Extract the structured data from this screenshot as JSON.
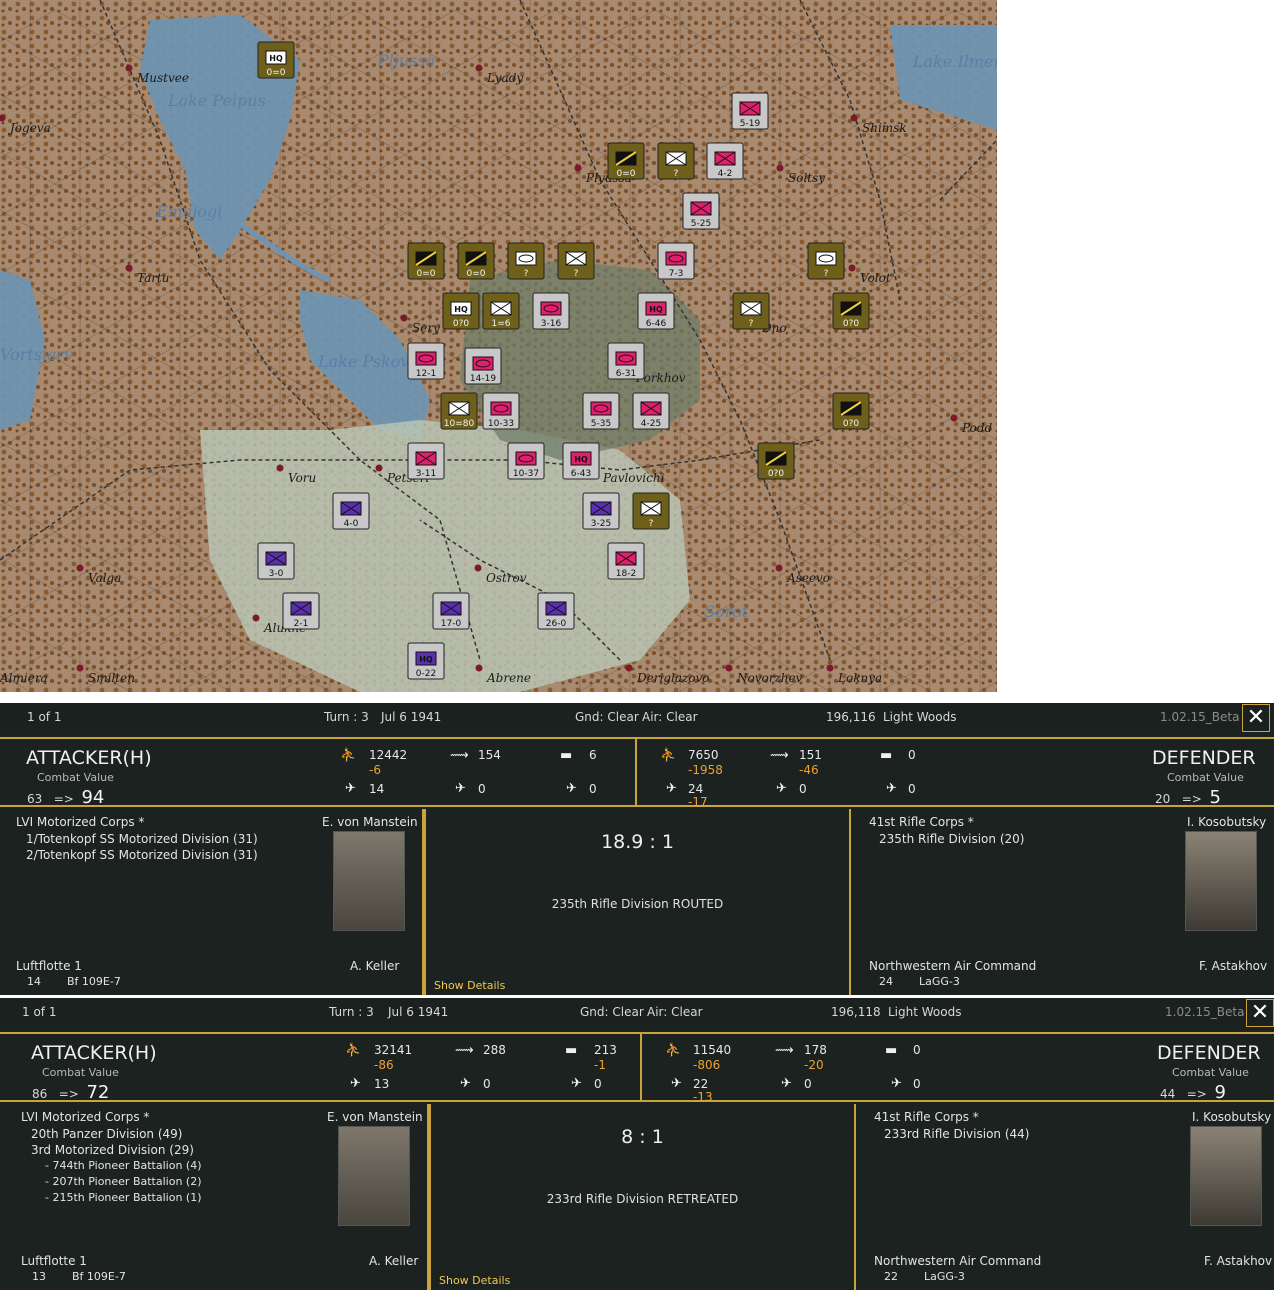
{
  "map": {
    "place_names": [
      "Mustvee",
      "Lake Peipus",
      "Jogeva",
      "Pljussa",
      "Lyady",
      "Lake Ilmen",
      "Shimsk",
      "Soltsy",
      "Plyussa",
      "Emajogi",
      "Tartu",
      "Volot",
      "Lake Pskov",
      "Porkhov",
      "Dno",
      "Vortsjarv",
      "Voru",
      "Petseri",
      "Pavlovichi",
      "Podd",
      "Valga",
      "Ostrov",
      "Aseevo",
      "Alukne",
      "Sorot",
      "Almiera",
      "Smilten",
      "Abrene",
      "Deriglazovo",
      "Novorzhev",
      "Loknya",
      "Sery"
    ],
    "units": [
      {
        "label": "0=0",
        "type": "HQ",
        "side": "german"
      },
      {
        "label": "5-19",
        "type": "infantry",
        "side": "soviet"
      },
      {
        "label": "0=0",
        "type": "R",
        "side": "german"
      },
      {
        "label": "?",
        "type": "infantry",
        "side": "soviet-hidden"
      },
      {
        "label": "4-2",
        "type": "infantry",
        "side": "soviet"
      },
      {
        "label": "5-25",
        "type": "infantry",
        "side": "soviet"
      },
      {
        "label": "0=0",
        "type": "R",
        "side": "german"
      },
      {
        "label": "0=0",
        "type": "R",
        "side": "german"
      },
      {
        "label": "?",
        "type": "armor",
        "side": "soviet-hidden"
      },
      {
        "label": "?",
        "type": "infantry",
        "side": "soviet-hidden"
      },
      {
        "label": "7-3",
        "type": "armor",
        "side": "soviet"
      },
      {
        "label": "?",
        "type": "armor",
        "side": "soviet-hidden"
      },
      {
        "label": "0?0",
        "type": "HQ",
        "side": "german"
      },
      {
        "label": "1=6",
        "type": "infantry",
        "side": "german"
      },
      {
        "label": "3-16",
        "type": "armor",
        "side": "soviet"
      },
      {
        "label": "6-46",
        "type": "HQ",
        "side": "soviet"
      },
      {
        "label": "?",
        "type": "infantry",
        "side": "soviet-hidden"
      },
      {
        "label": "0?0",
        "type": "R",
        "side": "german"
      },
      {
        "label": "12-1",
        "type": "armor",
        "side": "soviet"
      },
      {
        "label": "14-19",
        "type": "armor",
        "side": "soviet"
      },
      {
        "label": "6-31",
        "type": "armor",
        "side": "soviet"
      },
      {
        "label": "10=80",
        "type": "infantry",
        "side": "german"
      },
      {
        "label": "10-33",
        "type": "armor",
        "side": "soviet"
      },
      {
        "label": "5-35",
        "type": "armor",
        "side": "soviet"
      },
      {
        "label": "4-25",
        "type": "infantry",
        "side": "soviet"
      },
      {
        "label": "0?0",
        "type": "R",
        "side": "german"
      },
      {
        "label": "3-11",
        "type": "infantry",
        "side": "soviet"
      },
      {
        "label": "10-37",
        "type": "armor",
        "side": "soviet"
      },
      {
        "label": "6-43",
        "type": "HQ",
        "side": "soviet"
      },
      {
        "label": "0?0",
        "type": "R",
        "side": "german"
      },
      {
        "label": "4-0",
        "type": "infantry",
        "side": "axis-purple"
      },
      {
        "label": "3-25",
        "type": "infantry",
        "side": "axis-purple"
      },
      {
        "label": "?",
        "type": "infantry",
        "side": "soviet-hidden"
      },
      {
        "label": "3-0",
        "type": "infantry",
        "side": "axis-purple"
      },
      {
        "label": "18-2",
        "type": "infantry",
        "side": "soviet"
      },
      {
        "label": "2-1",
        "type": "infantry",
        "side": "axis-purple"
      },
      {
        "label": "17-0",
        "type": "infantry",
        "side": "axis-purple"
      },
      {
        "label": "26-0",
        "type": "infantry",
        "side": "axis-purple"
      },
      {
        "label": "0-22",
        "type": "HQ",
        "side": "axis-purple"
      }
    ]
  },
  "reports": [
    {
      "header": {
        "page": "1 of 1",
        "turn": "Turn : 3",
        "date": "Jul 6 1941",
        "gnd": "Gnd: Clear",
        "air": "Air: Clear",
        "hex": "196,116",
        "terrain": "Light Woods",
        "version": "1.02.15_Beta"
      },
      "attacker": {
        "title": "ATTACKER(H)",
        "cv_label": "Combat Value",
        "cv_from": "63",
        "arrow": "=>",
        "cv_to": "94",
        "men": "12442",
        "men_d": "-6",
        "guns": "154",
        "guns_d": "",
        "afv": "6",
        "afv_d": "",
        "air1": "14",
        "air2": "0",
        "air3": "0"
      },
      "defender": {
        "title": "DEFENDER",
        "cv_label": "Combat Value",
        "cv_from": "20",
        "arrow": "=>",
        "cv_to": "5",
        "men": "7650",
        "men_d": "-1958",
        "guns": "151",
        "guns_d": "-46",
        "afv": "0",
        "afv_d": "",
        "air1": "24",
        "air1_d": "-17",
        "air2": "0",
        "air3": "0"
      },
      "att_units": [
        "LVI Motorized Corps *",
        "1/Totenkopf SS Motorized Division (31)",
        "2/Totenkopf SS Motorized Division (31)"
      ],
      "att_leader": "E. von Manstein",
      "att_air": "Luftflotte 1",
      "att_air_leader": "A. Keller",
      "att_air_n": "14",
      "att_air_type": "Bf 109E-7",
      "ratio": "18.9 : 1",
      "result": "235th Rifle Division ROUTED",
      "show_details": "Show Details",
      "def_units": [
        "41st Rifle Corps *",
        "235th Rifle Division (20)"
      ],
      "def_leader": "I. Kosobutsky",
      "def_air": "Northwestern Air Command",
      "def_air_leader": "F. Astakhov",
      "def_air_n": "24",
      "def_air_type": "LaGG-3"
    },
    {
      "header": {
        "page": "1 of 1",
        "turn": "Turn : 3",
        "date": "Jul 6 1941",
        "gnd": "Gnd: Clear",
        "air": "Air: Clear",
        "hex": "196,118",
        "terrain": "Light Woods",
        "version": "1.02.15_Beta"
      },
      "attacker": {
        "title": "ATTACKER(H)",
        "cv_label": "Combat Value",
        "cv_from": "86",
        "arrow": "=>",
        "cv_to": "72",
        "men": "32141",
        "men_d": "-86",
        "guns": "288",
        "guns_d": "",
        "afv": "213",
        "afv_d": "-1",
        "air1": "13",
        "air2": "0",
        "air3": "0"
      },
      "defender": {
        "title": "DEFENDER",
        "cv_label": "Combat Value",
        "cv_from": "44",
        "arrow": "=>",
        "cv_to": "9",
        "men": "11540",
        "men_d": "-806",
        "guns": "178",
        "guns_d": "-20",
        "afv": "0",
        "afv_d": "",
        "air1": "22",
        "air1_d": "-13",
        "air2": "0",
        "air3": "0"
      },
      "att_units": [
        "LVI Motorized Corps *",
        "20th Panzer Division (49)",
        "3rd Motorized Division (29)",
        "- 744th Pioneer Battalion (4)",
        "- 207th Pioneer Battalion (2)",
        "- 215th Pioneer Battalion (1)"
      ],
      "att_leader": "E. von Manstein",
      "att_air": "Luftflotte 1",
      "att_air_leader": "A. Keller",
      "att_air_n": "13",
      "att_air_type": "Bf 109E-7",
      "ratio": "8 : 1",
      "result": "233rd Rifle Division RETREATED",
      "show_details": "Show Details",
      "def_units": [
        "41st Rifle Corps *",
        "233rd Rifle Division (44)"
      ],
      "def_leader": "I. Kosobutsky",
      "def_air": "Northwestern Air Command",
      "def_air_leader": "F. Astakhov",
      "def_air_n": "22",
      "def_air_type": "LaGG-3"
    }
  ],
  "colors": {
    "gold": "#c9a43a",
    "panel_bg": "#1c2220",
    "delta": "#f0a030",
    "soviet_unit": "#e0206e",
    "axis_purple": "#5a2fb0",
    "german_unit": "#7a6a20"
  }
}
